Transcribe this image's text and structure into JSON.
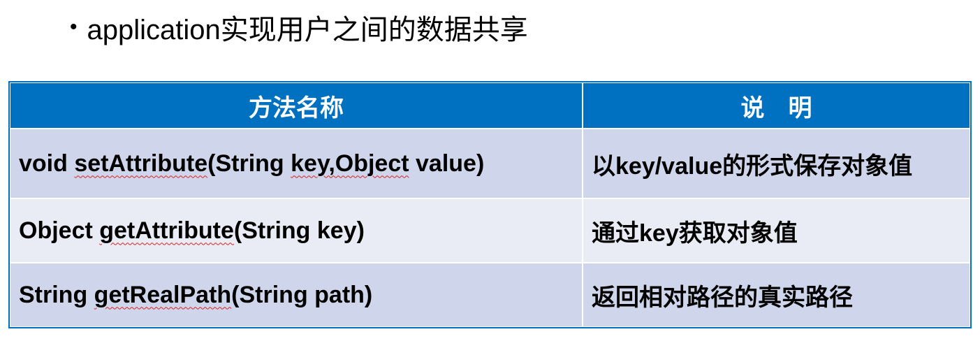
{
  "heading": {
    "bullet": "•",
    "text": "application实现用户之间的数据共享"
  },
  "table": {
    "headers": [
      "方法名称",
      "说　明"
    ],
    "rows": [
      {
        "method_prefix": "void ",
        "method_name": "setAttribute",
        "method_args_a": "(String ",
        "method_args_b": "key,Object",
        "method_args_c": " value)",
        "description": "以key/value的形式保存对象值"
      },
      {
        "method_prefix": "Object ",
        "method_name": "getAttribute",
        "method_args_a": "(String key)",
        "method_args_b": "",
        "method_args_c": "",
        "description": "通过key获取对象值"
      },
      {
        "method_prefix": "String ",
        "method_name": "getRealPath",
        "method_args_a": "(String path)",
        "method_args_b": "",
        "method_args_c": "",
        "description": "返回相对路径的真实路径"
      }
    ]
  },
  "colors": {
    "header_bg": "#0070c0",
    "row_dark": "#cfd5ea",
    "row_light": "#e9ebf5",
    "spellcheck": "#e02020"
  }
}
